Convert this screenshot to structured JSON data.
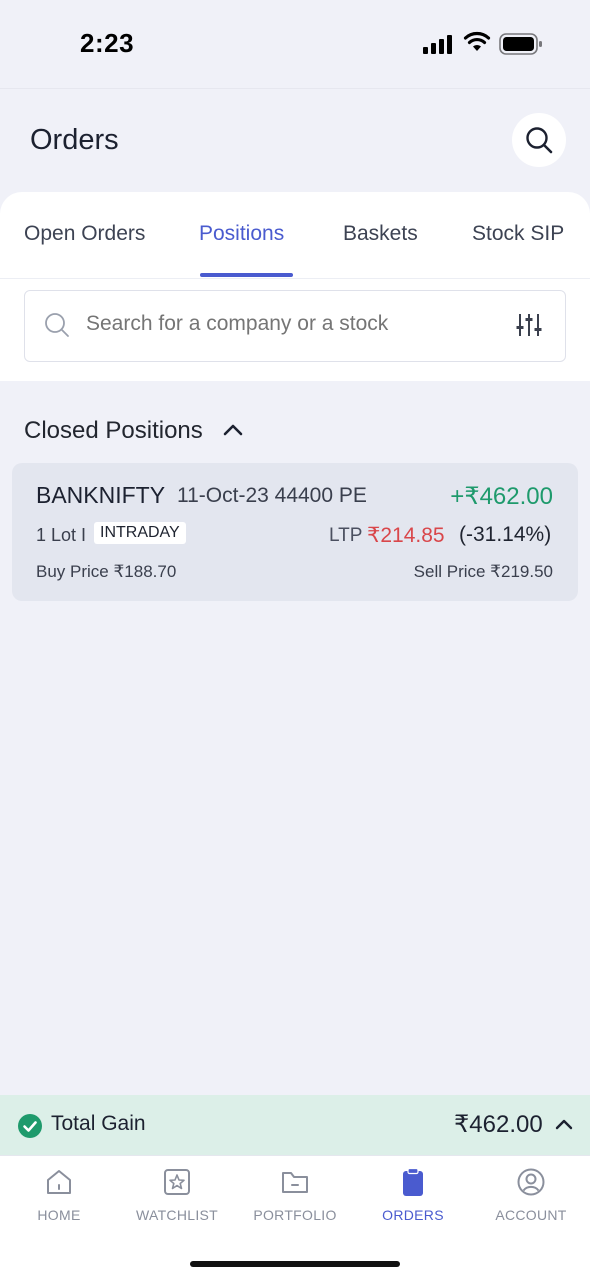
{
  "status_bar": {
    "time": "2:23"
  },
  "header": {
    "title": "Orders",
    "search_icon": "search-icon"
  },
  "tabs": [
    {
      "label": "Open Orders",
      "active": false
    },
    {
      "label": "Positions",
      "active": true
    },
    {
      "label": "Baskets",
      "active": false
    },
    {
      "label": "Stock SIP",
      "active": false
    }
  ],
  "search": {
    "placeholder": "Search for a company or a stock",
    "value": ""
  },
  "closed_positions": {
    "title": "Closed Positions",
    "items": [
      {
        "symbol": "BANKNIFTY",
        "contract": "11-Oct-23 44400 PE",
        "pnl": "+₹462.00",
        "lots": "1 Lot I",
        "product": "INTRADAY",
        "ltp_label": "LTP",
        "ltp": "₹214.85",
        "ltp_change": "(-31.14%)",
        "buy_price": "Buy Price ₹188.70",
        "sell_price": "Sell Price ₹219.50"
      }
    ]
  },
  "total": {
    "label": "Total Gain",
    "value": "₹462.00"
  },
  "bottom_nav": [
    {
      "label": "HOME",
      "icon": "home-icon",
      "active": false
    },
    {
      "label": "WATCHLIST",
      "icon": "star-icon",
      "active": false
    },
    {
      "label": "PORTFOLIO",
      "icon": "folder-icon",
      "active": false
    },
    {
      "label": "ORDERS",
      "icon": "clipboard-icon",
      "active": true
    },
    {
      "label": "ACCOUNT",
      "icon": "user-icon",
      "active": false
    }
  ],
  "colors": {
    "accent": "#4a5bcf",
    "gain": "#1e9a6c",
    "loss": "#d9464a",
    "background": "#f0f1f8"
  }
}
